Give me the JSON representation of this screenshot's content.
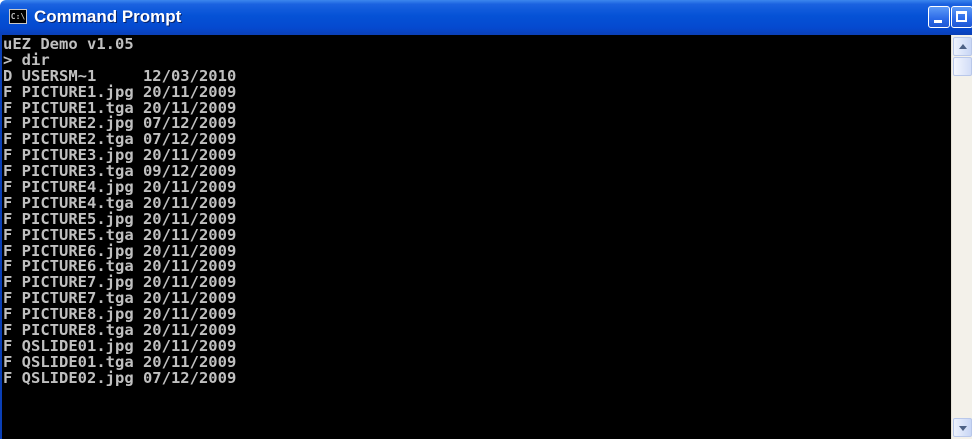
{
  "window": {
    "title": "Command Prompt",
    "icon": "cmd-icon",
    "icon_text": "C:\\",
    "controls": {
      "minimize_icon": "minimize-icon",
      "maximize_icon": "maximize-icon",
      "close_icon": "close-icon",
      "close_glyph": "×"
    },
    "colors": {
      "titlebar": "#0552d6",
      "console_bg": "#000000",
      "console_fg": "#c0c0c0",
      "close_button": "#d9502f"
    }
  },
  "console": {
    "lines": [
      "uEZ Demo v1.05",
      "> dir",
      "D USERSM~1     12/03/2010",
      "F PICTURE1.jpg 20/11/2009",
      "F PICTURE1.tga 20/11/2009",
      "F PICTURE2.jpg 07/12/2009",
      "F PICTURE2.tga 07/12/2009",
      "F PICTURE3.jpg 20/11/2009",
      "F PICTURE3.tga 09/12/2009",
      "F PICTURE4.jpg 20/11/2009",
      "F PICTURE4.tga 20/11/2009",
      "F PICTURE5.jpg 20/11/2009",
      "F PICTURE5.tga 20/11/2009",
      "F PICTURE6.jpg 20/11/2009",
      "F PICTURE6.tga 20/11/2009",
      "F PICTURE7.jpg 20/11/2009",
      "F PICTURE7.tga 20/11/2009",
      "F PICTURE8.jpg 20/11/2009",
      "F PICTURE8.tga 20/11/2009",
      "F QSLIDE01.jpg 20/11/2009",
      "F QSLIDE01.tga 20/11/2009",
      "F QSLIDE02.jpg 07/12/2009"
    ]
  },
  "scrollbar": {
    "up_icon": "scroll-up-arrow-icon",
    "down_icon": "scroll-down-arrow-icon",
    "position": 0
  }
}
